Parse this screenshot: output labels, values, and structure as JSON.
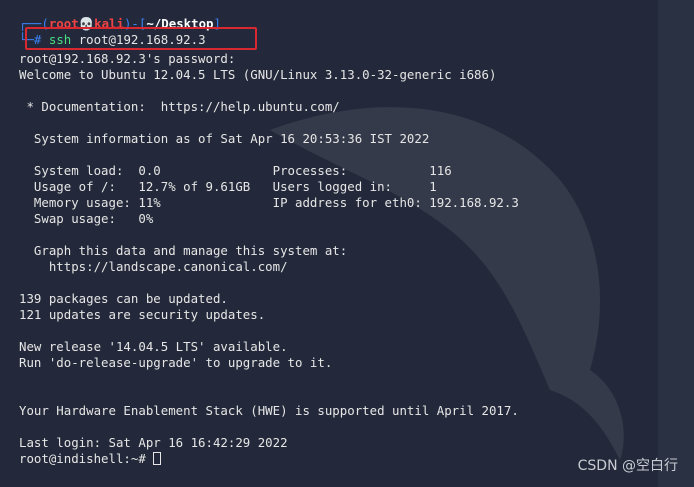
{
  "prompt": {
    "user": "root",
    "skull": "💀",
    "host": "kali",
    "dir": "~/Desktop",
    "hash": "#",
    "command": "ssh",
    "argument": "root@192.168.92.3"
  },
  "output": [
    "root@192.168.92.3's password:",
    "Welcome to Ubuntu 12.04.5 LTS (GNU/Linux 3.13.0-32-generic i686)",
    "",
    " * Documentation:  https://help.ubuntu.com/",
    "",
    "  System information as of Sat Apr 16 20:53:36 IST 2022",
    "",
    "  System load:  0.0               Processes:           116",
    "  Usage of /:   12.7% of 9.61GB   Users logged in:     1",
    "  Memory usage: 11%               IP address for eth0: 192.168.92.3",
    "  Swap usage:   0%",
    "",
    "  Graph this data and manage this system at:",
    "    https://landscape.canonical.com/",
    "",
    "139 packages can be updated.",
    "121 updates are security updates.",
    "",
    "New release '14.04.5 LTS' available.",
    "Run 'do-release-upgrade' to upgrade to it.",
    "",
    "",
    "Your Hardware Enablement Stack (HWE) is supported until April 2017.",
    "",
    "Last login: Sat Apr 16 16:42:29 2022"
  ],
  "final_prompt": "root@indishell:~# ",
  "watermark": "CSDN @空白行",
  "colors": {
    "background": "#23293a",
    "prompt_blue": "#3b82f6",
    "prompt_red": "#ef4444",
    "command_green": "#4ade80",
    "highlight_box": "#d9282f"
  }
}
